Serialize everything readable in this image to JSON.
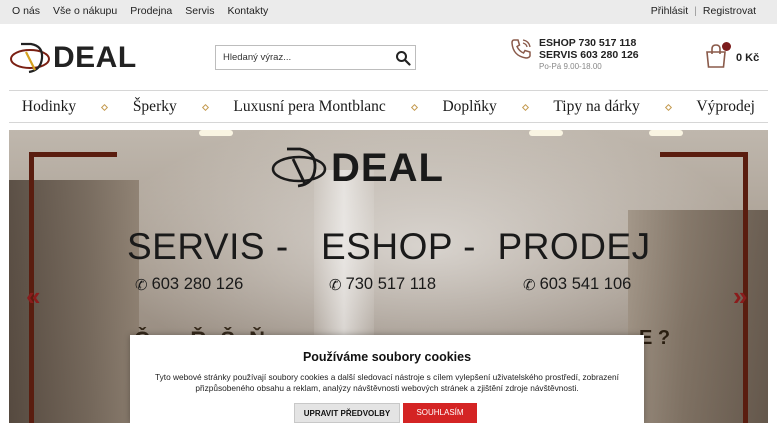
{
  "topbar": {
    "links": [
      "O nás",
      "Vše o nákupu",
      "Prodejna",
      "Servis",
      "Kontakty"
    ],
    "login": "Přihlásit",
    "separator": "|",
    "register": "Registrovat"
  },
  "header": {
    "logo_text": "DEAL",
    "search_placeholder": "Hledaný výraz...",
    "eshop_phone": "ESHOP 730 517 118",
    "servis_phone": "SERVIS 603 280 126",
    "hours": "Po-Pá 9.00-18.00",
    "cart_total": "0 Kč"
  },
  "nav": {
    "items": [
      "Hodinky",
      "Šperky",
      "Luxusní pera Montblanc",
      "Doplňky",
      "Tipy na dárky",
      "Výprodej"
    ]
  },
  "hero": {
    "logo_text": "DEAL",
    "headline": "SERVIS -   ESHOP -  PRODEJ",
    "phones": [
      "603 280 126",
      "730 517 118",
      "603 541 106"
    ],
    "partial_line_start": "Č  _  Ř  Š  Ň",
    "partial_line_end": "E ?"
  },
  "cookie": {
    "title": "Používáme soubory cookies",
    "text": "Tyto webové stránky používají soubory cookies a další sledovací nástroje s cílem vylepšení uživatelského prostředí, zobrazení přizpůsobeného obsahu a reklam, analýzy návštěvnosti webových stránek a zjištění zdroje návštěvnosti.",
    "settings_label": "UPRAVIT PŘEDVOLBY",
    "accept_label": "SOUHLASÍM"
  },
  "colors": {
    "accent_red": "#d42424",
    "brand_dark_red": "#5a1d0f",
    "nav_diamond": "#c49a4e"
  }
}
